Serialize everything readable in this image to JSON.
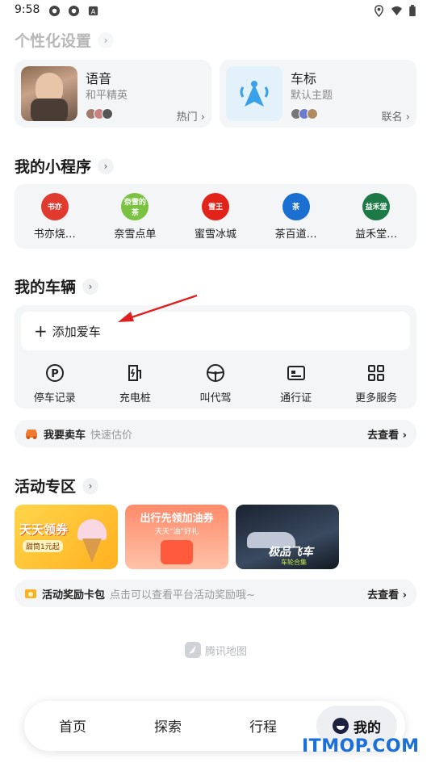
{
  "status": {
    "time": "9:58"
  },
  "personal": {
    "title": "个性化设置"
  },
  "voice_card": {
    "title": "语音",
    "subtitle": "和平精英",
    "tag": "热门"
  },
  "logo_card": {
    "title": "车标",
    "subtitle": "默认主题",
    "tag": "联名"
  },
  "mini_programs": {
    "title": "我的小程序",
    "items": [
      {
        "label": "书亦烧…",
        "color": "#e03a2f",
        "icon": "书亦"
      },
      {
        "label": "奈雪点单",
        "color": "#7bc142",
        "icon": "奈雪的茶"
      },
      {
        "label": "蜜雪冰城",
        "color": "#e2231a",
        "icon": "雪王"
      },
      {
        "label": "茶百道…",
        "color": "#1b6fd1",
        "icon": "茶"
      },
      {
        "label": "益禾堂…",
        "color": "#1d7a46",
        "icon": "益禾堂"
      }
    ]
  },
  "vehicles": {
    "title": "我的车辆",
    "add_label": "添加爱车",
    "services": [
      {
        "label": "停车记录",
        "icon": "parking-icon"
      },
      {
        "label": "充电桩",
        "icon": "charging-icon"
      },
      {
        "label": "叫代驾",
        "icon": "steering-wheel-icon"
      },
      {
        "label": "通行证",
        "icon": "pass-card-icon"
      },
      {
        "label": "更多服务",
        "icon": "grid-icon"
      }
    ]
  },
  "sell_car": {
    "title": "我要卖车",
    "subtitle": "快速估价",
    "action": "去查看"
  },
  "activities": {
    "title": "活动专区",
    "promos": [
      {
        "text": "天天领券",
        "sub": "甜筒1元起"
      },
      {
        "text": "出行先领加油券",
        "sub": "天天“油”好礼"
      },
      {
        "text": "极品飞车",
        "sub": "车轮合集"
      }
    ]
  },
  "reward": {
    "title": "活动奖励卡包",
    "subtitle": "点击可以查看平台活动奖励哦~",
    "action": "去查看"
  },
  "footer": {
    "brand": "腾讯地图"
  },
  "tabs": [
    {
      "label": "首页"
    },
    {
      "label": "探索"
    },
    {
      "label": "行程"
    },
    {
      "label": "我的"
    }
  ],
  "watermark": "ITMOP.COM"
}
